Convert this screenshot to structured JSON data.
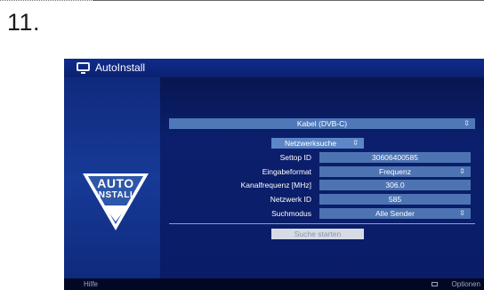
{
  "step": {
    "number": "11."
  },
  "window": {
    "title": "AutoInstall"
  },
  "logo": {
    "line1": "AUTO",
    "line2": "INSTALL"
  },
  "main": {
    "source": {
      "label": "Kabel (DVB-C)",
      "arrow": "⇳"
    },
    "scan_mode": {
      "label": "Netzwerksuche",
      "arrow": "⇳"
    },
    "fields": [
      {
        "label": "Settop ID",
        "value": "30606400585",
        "arrow": ""
      },
      {
        "label": "Eingabeformat",
        "value": "Frequenz",
        "arrow": "⇳"
      },
      {
        "label": "Kanalfrequenz [MHz]",
        "value": "306.0",
        "arrow": ""
      },
      {
        "label": "Netzwerk ID",
        "value": "585",
        "arrow": ""
      },
      {
        "label": "Suchmodus",
        "value": "Alle Sender",
        "arrow": "⇳"
      }
    ],
    "start_button": "Suche starten"
  },
  "footer": {
    "help": "Hilfe",
    "options": "Optionen"
  }
}
